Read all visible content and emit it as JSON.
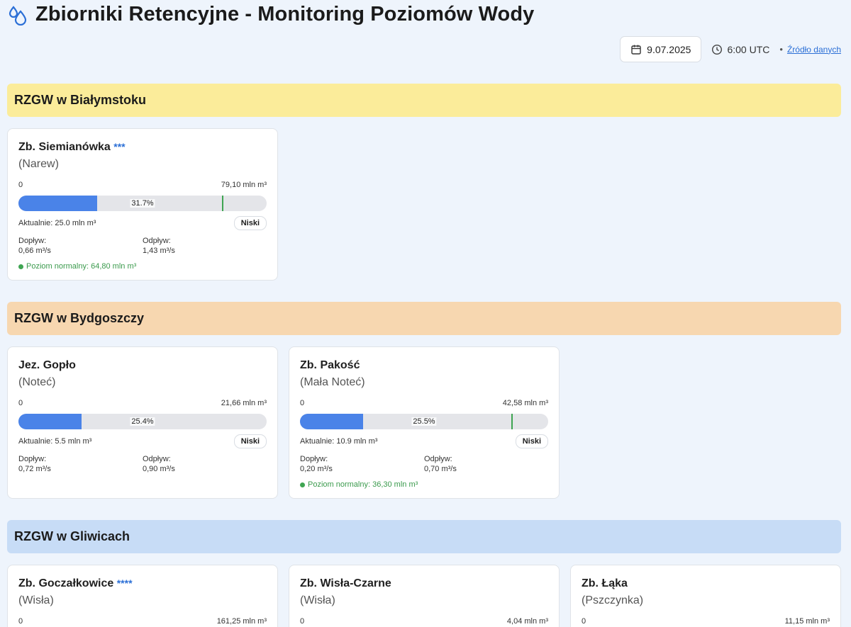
{
  "app": {
    "title": "Zbiorniki Retencyjne - Monitoring Poziomów Wody",
    "date": "9.07.2025",
    "time": "6:00 UTC",
    "separator": "•",
    "source_link": "Źródło danych"
  },
  "labels": {
    "scale_min": "0",
    "current_prefix": "Aktualnie:",
    "inflow_label": "Dopływ:",
    "outflow_label": "Odpływ:",
    "normal_prefix": "Poziom normalny:"
  },
  "sections": [
    {
      "title": "RZGW w Białymstoku",
      "color": "#fbec9a",
      "reservoirs": [
        {
          "name": "Zb. Siemianówka",
          "stars": "***",
          "river": "(Narew)",
          "capacity": "79,10 mln m³",
          "fill_percent": 31.7,
          "percent_label": "31.7%",
          "normal_mark_percent": 82,
          "current": "Aktualnie: 25.0 mln m³",
          "status": "Niski",
          "inflow": "0,66 m³/s",
          "outflow": "1,43 m³/s",
          "normal": "Poziom normalny: 64,80 mln m³"
        }
      ]
    },
    {
      "title": "RZGW w Bydgoszczy",
      "color": "#f7d7b0",
      "reservoirs": [
        {
          "name": "Jez. Gopło",
          "stars": "",
          "river": "(Noteć)",
          "capacity": "21,66 mln m³",
          "fill_percent": 25.4,
          "percent_label": "25.4%",
          "current": "Aktualnie: 5.5 mln m³",
          "status": "Niski",
          "inflow": "0,72 m³/s",
          "outflow": "0,90 m³/s"
        },
        {
          "name": "Zb. Pakość",
          "stars": "",
          "river": "(Mała Noteć)",
          "capacity": "42,58 mln m³",
          "fill_percent": 25.5,
          "percent_label": "25.5%",
          "normal_mark_percent": 85,
          "current": "Aktualnie: 10.9 mln m³",
          "status": "Niski",
          "inflow": "0,20 m³/s",
          "outflow": "0,70 m³/s",
          "normal": "Poziom normalny: 36,30 mln m³"
        }
      ]
    },
    {
      "title": "RZGW w Gliwicach",
      "color": "#c7dcf6",
      "reservoirs": [
        {
          "name": "Zb. Goczałkowice",
          "stars": "****",
          "river": "(Wisła)",
          "capacity": "161,25 mln m³"
        },
        {
          "name": "Zb. Wisła-Czarne",
          "stars": "",
          "river": "(Wisła)",
          "capacity": "4,04 mln m³"
        },
        {
          "name": "Zb. Łąka",
          "stars": "",
          "river": "(Pszczynka)",
          "capacity": "11,15 mln m³"
        }
      ]
    }
  ]
}
